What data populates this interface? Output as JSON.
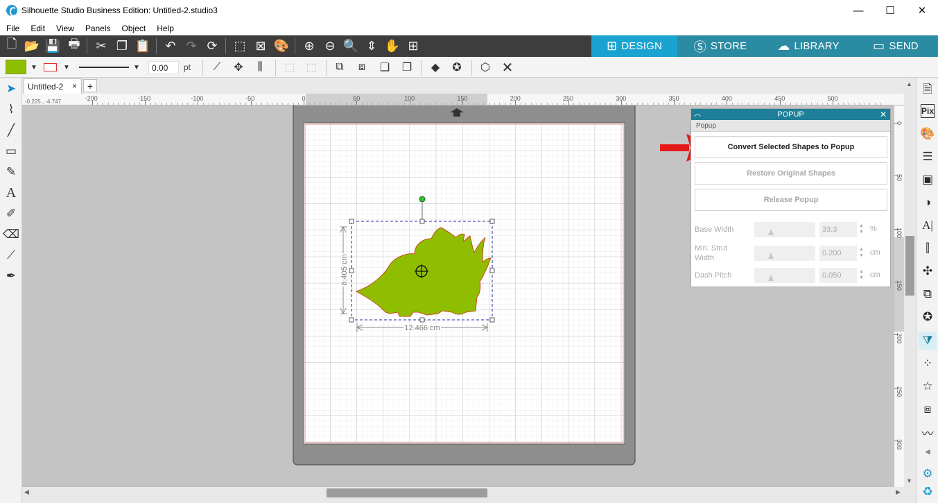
{
  "window": {
    "title": "Silhouette Studio Business Edition: Untitled-2.studio3",
    "minimize": "—",
    "maximize": "☐",
    "close": "✕"
  },
  "menu": [
    "File",
    "Edit",
    "View",
    "Panels",
    "Object",
    "Help"
  ],
  "tabs": [
    {
      "label": "DESIGN",
      "icon": "grid-icon"
    },
    {
      "label": "STORE",
      "icon": "store-icon"
    },
    {
      "label": "LIBRARY",
      "icon": "cloud-icon"
    },
    {
      "label": "SEND",
      "icon": "cutter-icon"
    }
  ],
  "colors": {
    "toolbar": "#3d3d3d",
    "active_tab": "#1aa3d1",
    "inactive_tab": "#2b8ba3",
    "fill": "#8fbe00",
    "outline": "#e03030",
    "popup_header": "#1f7f98",
    "arrow": "#e41a1a"
  },
  "toolbar2": {
    "line_width": "0.00",
    "unit": "pt"
  },
  "document": {
    "tab_label": "Untitled-2",
    "close": "×",
    "add": "+"
  },
  "ruler": {
    "h_labels": [
      "-200",
      "-150",
      "-100",
      "-50",
      "0",
      "50",
      "100",
      "150",
      "200",
      "250",
      "300",
      "350",
      "400",
      "450",
      "500"
    ],
    "v_labels": [
      "0",
      "50",
      "100",
      "150",
      "200",
      "250",
      "300"
    ],
    "coords": "-0.225 , -4.747"
  },
  "selection": {
    "width": "12.466 cm",
    "height": "8.405 cm"
  },
  "popup": {
    "title": "POPUP",
    "section": "Popup",
    "buttons": {
      "convert": "Convert Selected Shapes to Popup",
      "restore": "Restore Original Shapes",
      "release": "Release Popup"
    },
    "fields": [
      {
        "label": "Base Width",
        "value": "33.3",
        "unit": "%"
      },
      {
        "label": "Min. Strut Width",
        "value": "0.200",
        "unit": "cm"
      },
      {
        "label": "Dash Pitch",
        "value": "0.050",
        "unit": "cm"
      }
    ]
  }
}
